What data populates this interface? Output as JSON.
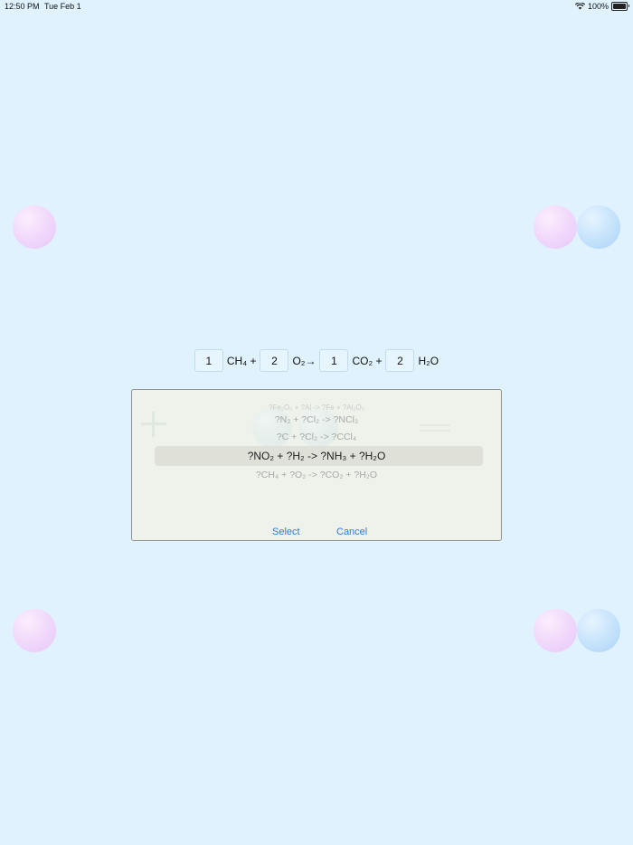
{
  "status_bar": {
    "time": "12:50 PM",
    "date": "Tue Feb 1",
    "battery": "100%"
  },
  "equation": {
    "coef1": "1",
    "term1": "CH₄ +",
    "coef2": "2",
    "term2": "O₂→",
    "coef3": "1",
    "term3": "CO₂ +",
    "coef4": "2",
    "term4": "H₂O"
  },
  "picker": {
    "options": [
      "?Fe₂O₃ + ?Al -> ?Fe + ?Al₂O₃",
      "?N₂ + ?Cl₂ -> ?NCl₃",
      "?C + ?Cl₂ -> ?CCl₄",
      "?NO₂ + ?H₂ -> ?NH₃ + ?H₂O",
      "?CH₄ + ?O₂ -> ?CO₂ + ?H₂O"
    ],
    "selected_index": 3,
    "select_label": "Select",
    "cancel_label": "Cancel"
  },
  "colors": {
    "background": "#dff2fe",
    "accent": "#2c7bd7"
  }
}
